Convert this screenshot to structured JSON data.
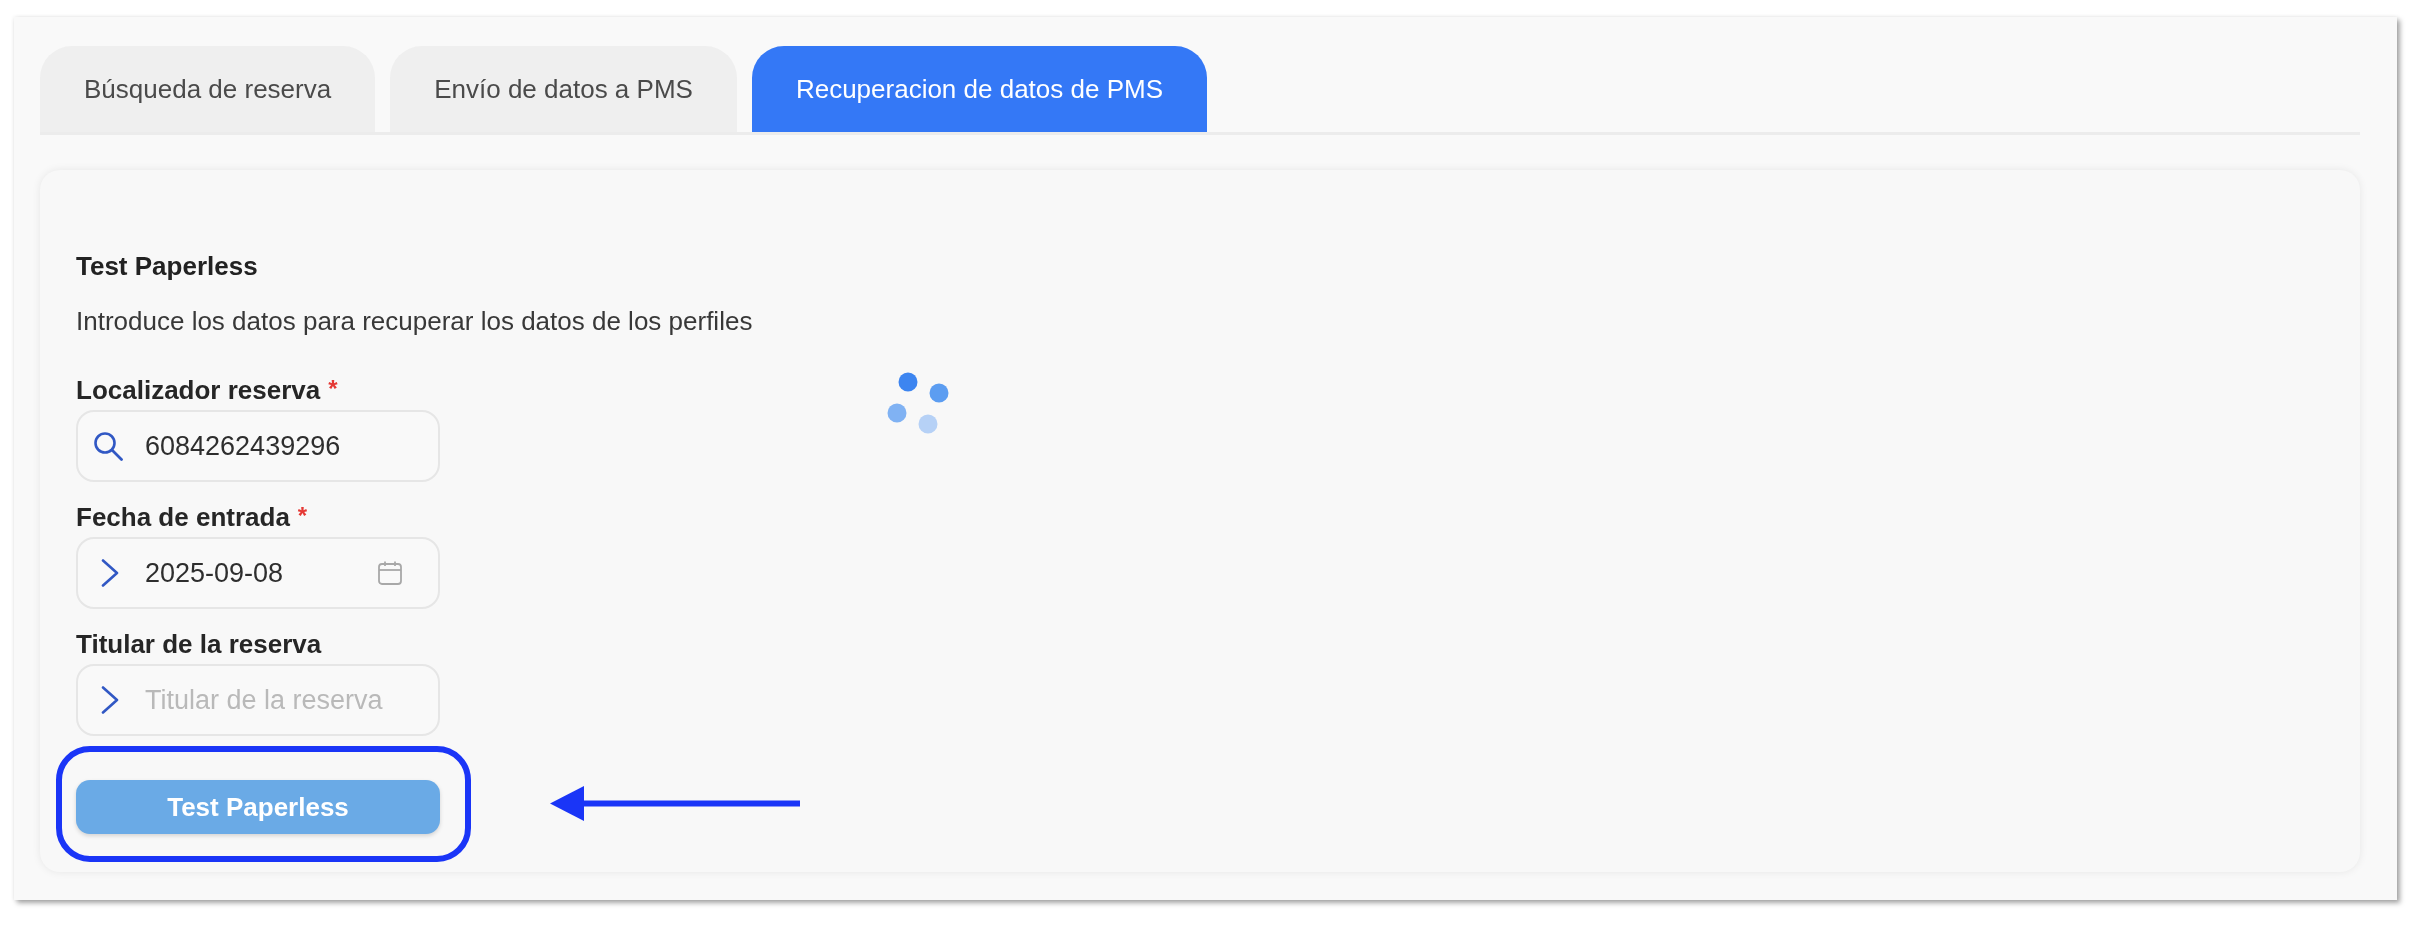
{
  "tabs": [
    {
      "label": "Búsqueda de reserva",
      "selected": false
    },
    {
      "label": "Envío de datos a PMS",
      "selected": false
    },
    {
      "label": "Recuperacion de datos de PMS",
      "selected": true
    }
  ],
  "form": {
    "title": "Test Paperless",
    "description": "Introduce los datos para recuperar los datos de los perfiles",
    "fields": [
      {
        "kind": "search",
        "label": "Localizador reserva",
        "required_marker": "*",
        "value": "6084262439296"
      },
      {
        "kind": "date",
        "label": "Fecha de entrada",
        "required_marker": "*",
        "value": "2025-09-08"
      },
      {
        "kind": "text",
        "label": "Titular de la reserva",
        "placeholder": "Titular de la reserva"
      }
    ],
    "submit_button": {
      "label": "Test Paperless",
      "disabled": true
    }
  },
  "loading": true
}
